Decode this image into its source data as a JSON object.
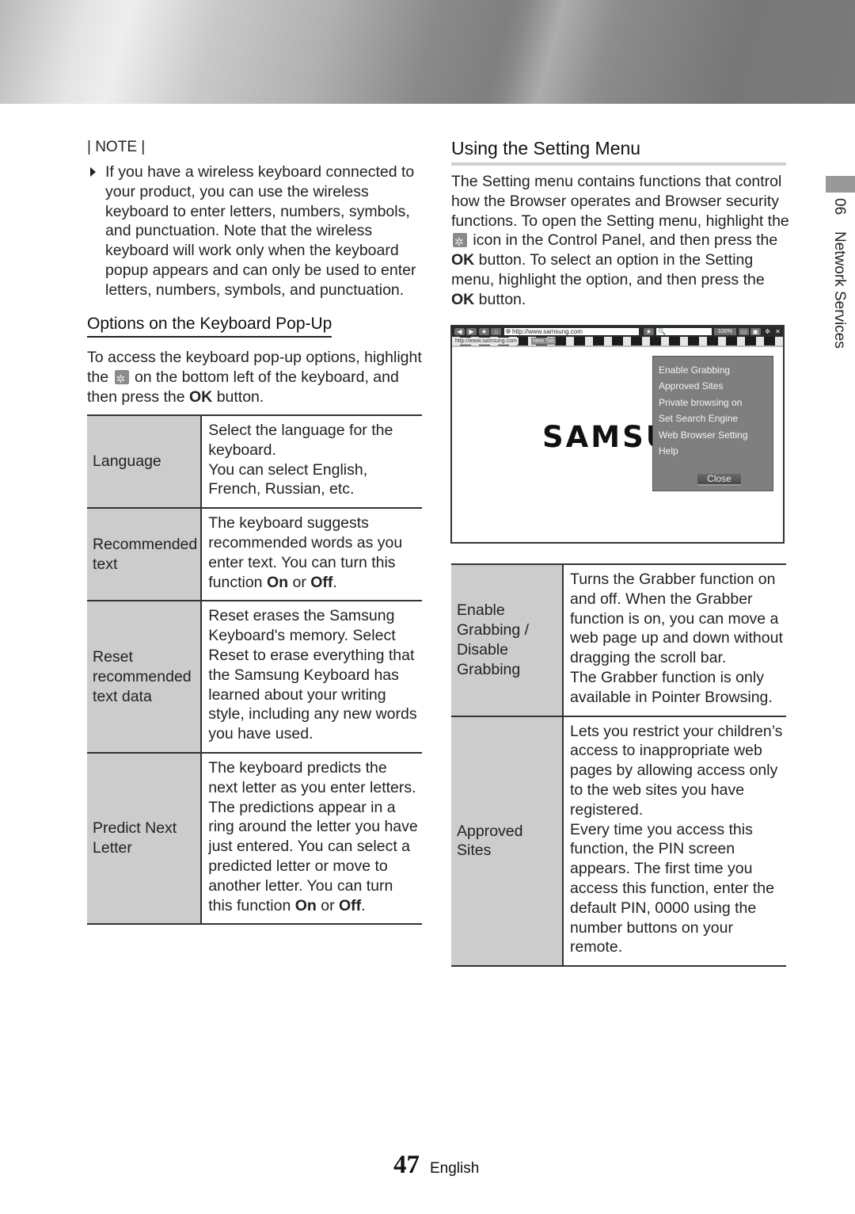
{
  "side_nav": {
    "chapter_number": "06",
    "chapter_title": "Network Services"
  },
  "note": {
    "title": "| NOTE |",
    "items": [
      "If you have a wireless keyboard connected to your product, you can use the wireless keyboard to enter letters, numbers, symbols, and punctuation. Note that the wireless keyboard will work only when the keyboard popup appears and can only be used to enter letters, numbers, symbols, and punctuation."
    ]
  },
  "keyboard_section": {
    "heading": "Options on the Keyboard Pop-Up",
    "intro_before_icon": "To access the keyboard pop-up options, highlight the",
    "intro_icon": "gear-icon",
    "intro_after_icon": "on the bottom left of the keyboard, and then press the",
    "intro_ok": "OK",
    "intro_end": "button.",
    "options": [
      {
        "name": "Language",
        "description": "Select the language for the keyboard.\nYou can select English, French, Russian, etc."
      },
      {
        "name": "Recommended text",
        "description_before": "The keyboard suggests recommended words as you enter text. You can turn this function",
        "on": "On",
        "or": "or",
        "off": "Off",
        "end": "."
      },
      {
        "name": "Reset recommended text data",
        "description": "Reset erases the Samsung Keyboard's memory. Select Reset to erase everything that the Samsung Keyboard has learned about your writing style, including any new words you have used."
      },
      {
        "name": "Predict Next Letter",
        "description_before": "The keyboard predicts the next letter as you enter letters. The predictions appear in a ring around the letter you have just entered. You can select a predicted letter or move to another letter. You can turn this function",
        "on": "On",
        "or": "or",
        "off": "Off",
        "end": "."
      }
    ]
  },
  "setting_section": {
    "heading": "Using the Setting Menu",
    "intro_before_icon": "The Setting menu contains functions that control how the Browser operates and Browser security functions. To open the Setting menu, highlight the",
    "intro_icon": "gear-icon",
    "intro_after_icon": "icon in the Control Panel, and then press the",
    "intro_ok": "OK",
    "intro_mid": "button. To select an option in the Setting menu, highlight the option, and then press the",
    "intro_ok2": "OK",
    "intro_end": "button.",
    "browser_screenshot": {
      "url": "http://www.samsung.com",
      "tab_label": "http://www.samsung.com",
      "new_tab_label": "New Tab",
      "search_placeholder": "🔍",
      "zoom_level": "100%",
      "logo_text": "SAMSU",
      "menu_items": [
        "Enable Grabbing",
        "Approved Sites",
        "Private browsing on",
        "Set Search Engine",
        "Web Browser Setting",
        "Help"
      ],
      "close_label": "Close"
    },
    "options": [
      {
        "name": "Enable Grabbing / Disable Grabbing",
        "description": "Turns the Grabber function on and off. When the Grabber function is on, you can move a web page up and down without dragging the scroll bar.\nThe Grabber function is only available in Pointer Browsing."
      },
      {
        "name": "Approved Sites",
        "description": "Lets you restrict your children’s access to inappropriate web pages by allowing access only to the web sites you have registered.\nEvery time you access this function, the PIN screen appears. The first time you access this function, enter the default PIN, 0000 using the number buttons on your remote."
      }
    ]
  },
  "footer": {
    "page_number": "47",
    "language": "English"
  }
}
